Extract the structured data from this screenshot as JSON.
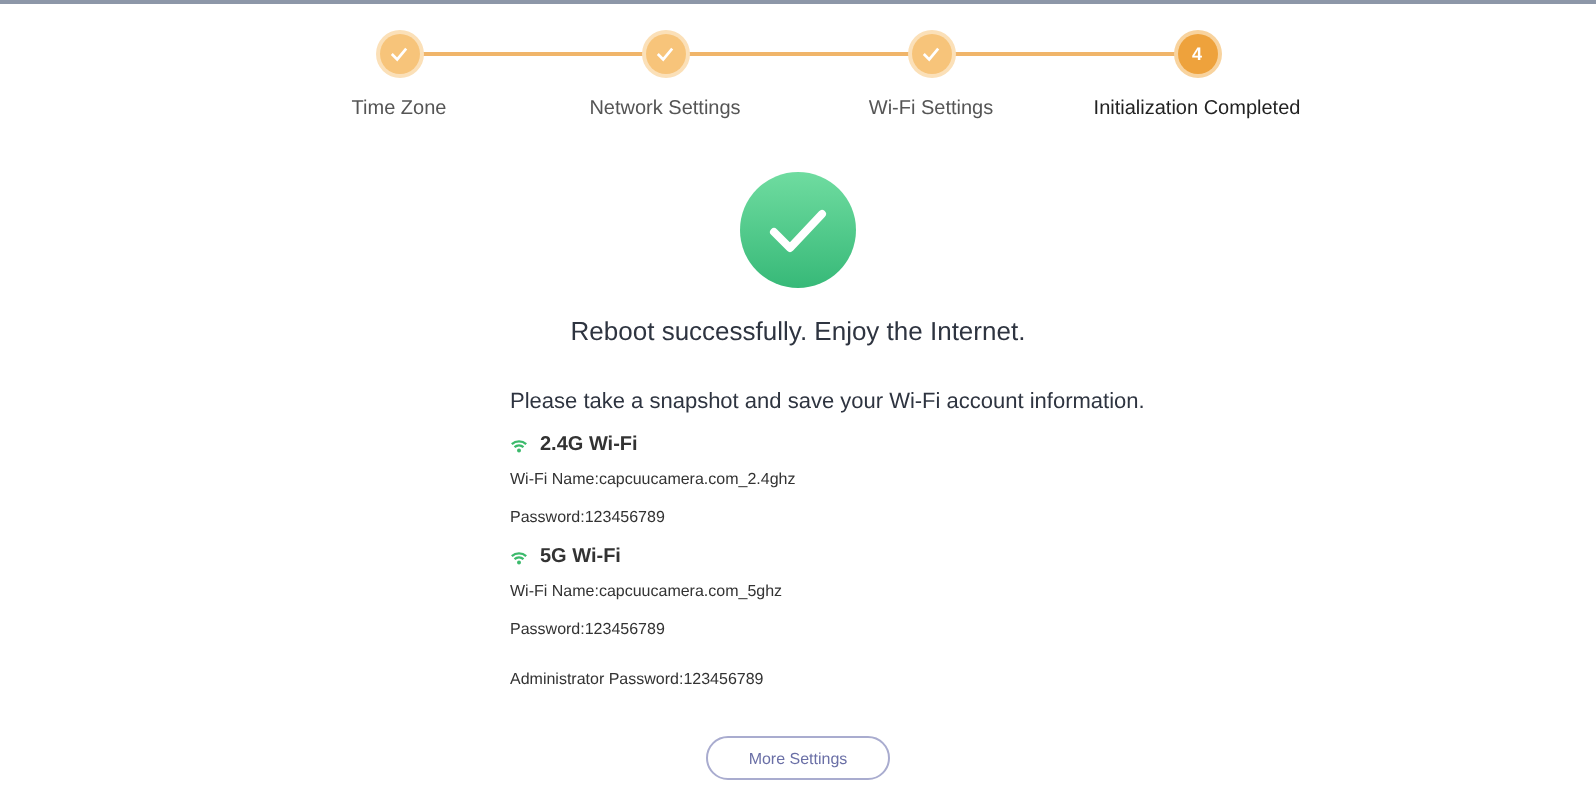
{
  "steps": [
    {
      "label": "Time Zone",
      "completed": true
    },
    {
      "label": "Network Settings",
      "completed": true
    },
    {
      "label": "Wi-Fi Settings",
      "completed": true
    },
    {
      "label": "Initialization Completed",
      "completed": false,
      "number": "4"
    }
  ],
  "message": "Reboot successfully. Enjoy the Internet.",
  "instruction": "Please take a snapshot and save your Wi-Fi account information.",
  "networks": [
    {
      "title": "2.4G Wi-Fi",
      "name": "Wi-Fi Name:capcuucamera.com_2.4ghz",
      "password": "Password:123456789"
    },
    {
      "title": "5G Wi-Fi",
      "name": "Wi-Fi Name:capcuucamera.com_5ghz",
      "password": "Password:123456789"
    }
  ],
  "admin_password": "Administrator Password:123456789",
  "button": "More Settings"
}
